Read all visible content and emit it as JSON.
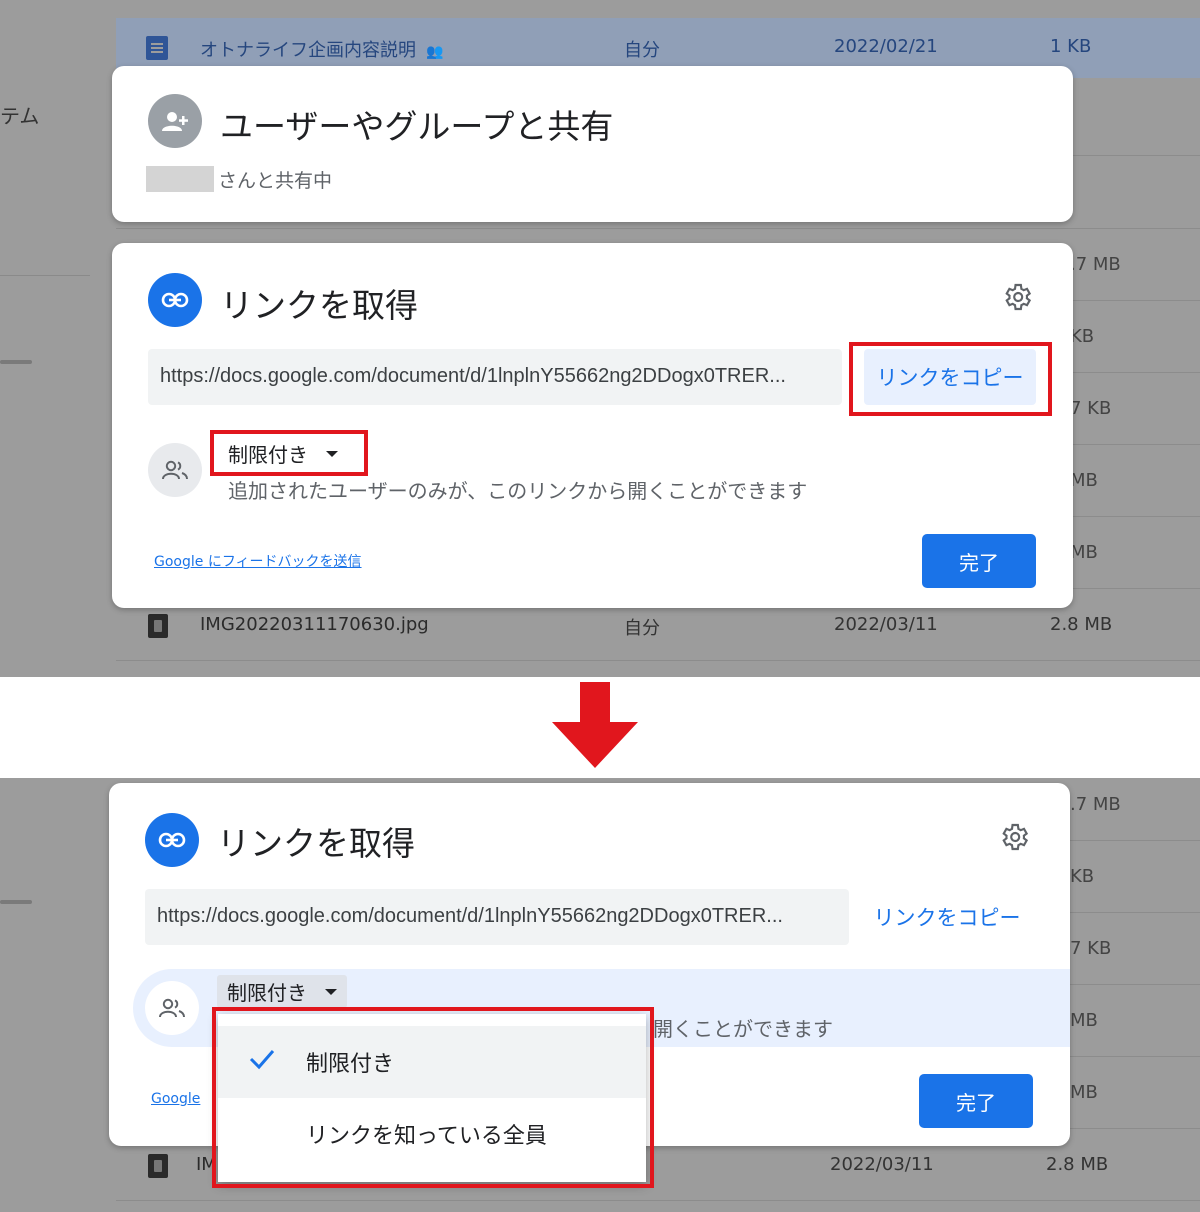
{
  "colors": {
    "accent": "#1a73e8",
    "annotation_red": "#e1161d",
    "overlay_grey": "#9c9c9c"
  },
  "background": {
    "sidebar_fragment": "テム",
    "highlighted_file": {
      "name": "オトナライフ企画内容説明",
      "owner": "自分",
      "date": "2022/02/21",
      "size": "1 KB",
      "icon": "doc-icon"
    },
    "image_file": {
      "name": "IMG20220311170630.jpg",
      "owner": "自分",
      "date": "2022/03/11",
      "size": "2.8 MB",
      "icon": "image-icon"
    },
    "sizes_top": [
      ".7 MB",
      "KB",
      "7 KB",
      "MB",
      "MB"
    ],
    "sizes_bottom": [
      ".7 MB",
      "KB",
      "7 KB",
      "MB",
      "MB"
    ]
  },
  "share_people_card": {
    "icon": "add-person-icon",
    "title": "ユーザーやグループと共有",
    "subtitle": "さんと共有中"
  },
  "link_card": {
    "icon": "link-icon",
    "title": "リンクを取得",
    "settings_icon": "gear-icon",
    "url": "https://docs.google.com/document/d/1lnplnY55662ng2DDogx0TRER...",
    "copy_label": "リンクをコピー",
    "access_icon": "people-icon",
    "access_value": "制限付き",
    "access_description": "追加されたユーザーのみが、このリンクから開くことができます",
    "feedback_label": "Google にフィードバックを送信",
    "done_label": "完了"
  },
  "bottom_panel": {
    "title": "リンクを取得",
    "url": "https://docs.google.com/document/d/1lnplnY55662ng2DDogx0TRER...",
    "copy_label": "リンクをコピー",
    "access_value": "制限付き",
    "access_description_visible": "開くことができます",
    "feedback_label_visible": "Google",
    "done_label": "完了",
    "image_file_name_visible": "IM",
    "image_file_date": "2022/03/11",
    "image_file_size": "2.8 MB",
    "dropdown": {
      "options": [
        {
          "label": "制限付き",
          "selected": true
        },
        {
          "label": "リンクを知っている全員",
          "selected": false
        }
      ]
    }
  },
  "transition_arrow": "down-arrow-icon"
}
